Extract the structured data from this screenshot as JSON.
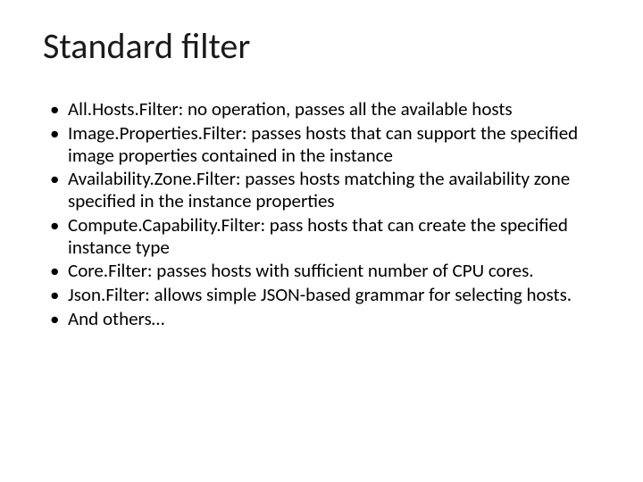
{
  "slide": {
    "title": "Standard filter",
    "bullets": [
      "All.Hosts.Filter: no operation, passes all the available hosts",
      "Image.Properties.Filter: passes hosts that can support the specified image properties contained in the instance",
      "Availability.Zone.Filter: passes hosts matching the availability zone specified in the instance properties",
      "Compute.Capability.Filter: pass hosts that can create the specified instance type",
      "Core.Filter: passes hosts with sufficient number of CPU cores.",
      "Json.Filter: allows simple JSON-based grammar for selecting hosts.",
      "And others…"
    ]
  }
}
